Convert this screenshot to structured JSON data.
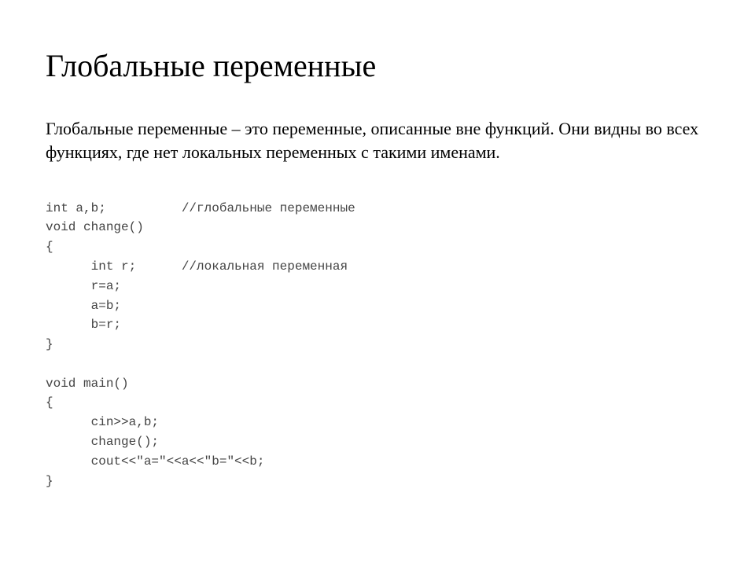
{
  "heading": "Глобальные переменные",
  "description": "Глобальные переменные – это переменные, описанные вне функций. Они видны во всех функциях, где нет локальных переменных с такими именами.",
  "code": {
    "l1": "int a,b;          //глобальные переменные",
    "l2": "void change()",
    "l3": "{",
    "l4": "      int r;      //локальная переменная",
    "l5": "      r=a;",
    "l6": "      a=b;",
    "l7": "      b=r;",
    "l8": "}",
    "l9": "",
    "l10": "void main()",
    "l11": "{",
    "l12": "      cin>>a,b;",
    "l13": "      change();",
    "l14": "      cout<<\"a=\"<<a<<\"b=\"<<b;",
    "l15": "}"
  }
}
